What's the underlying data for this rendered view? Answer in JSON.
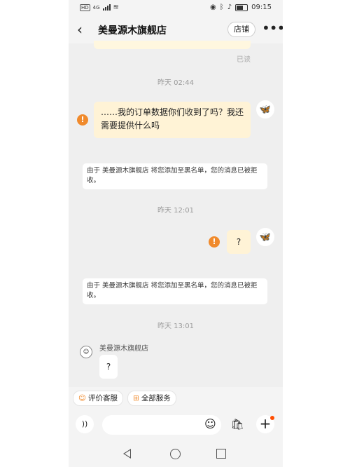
{
  "status_bar": {
    "left_badge": "HD",
    "network": "4G",
    "time": "09:15"
  },
  "header": {
    "title": "美曼源木旗舰店",
    "shop_button": "店铺",
    "more_icon": "more-dots-icon"
  },
  "messages": {
    "read_label": "已读",
    "time1": "昨天  02:44",
    "msg1": "……我的订单数据你们收到了吗？我还需要提供什么吗",
    "system1": "由于 美曼源木旗舰店 将您添加至黑名单，您的消息已被拒收。",
    "time2": "昨天  12:01",
    "msg2": "?",
    "system2": "由于 美曼源木旗舰店 将您添加至黑名单，您的消息已被拒收。",
    "time3": "昨天  13:01",
    "shop_name": "美曼源木旗舰店",
    "shop_msg": "?"
  },
  "quick_actions": {
    "rate_service": "评价客服",
    "all_services": "全部服务"
  },
  "input_bar": {
    "placeholder": ""
  },
  "colors": {
    "my_bubble": "#fff3d6",
    "error": "#f08a2c",
    "badge_dot": "#ff4d00"
  }
}
